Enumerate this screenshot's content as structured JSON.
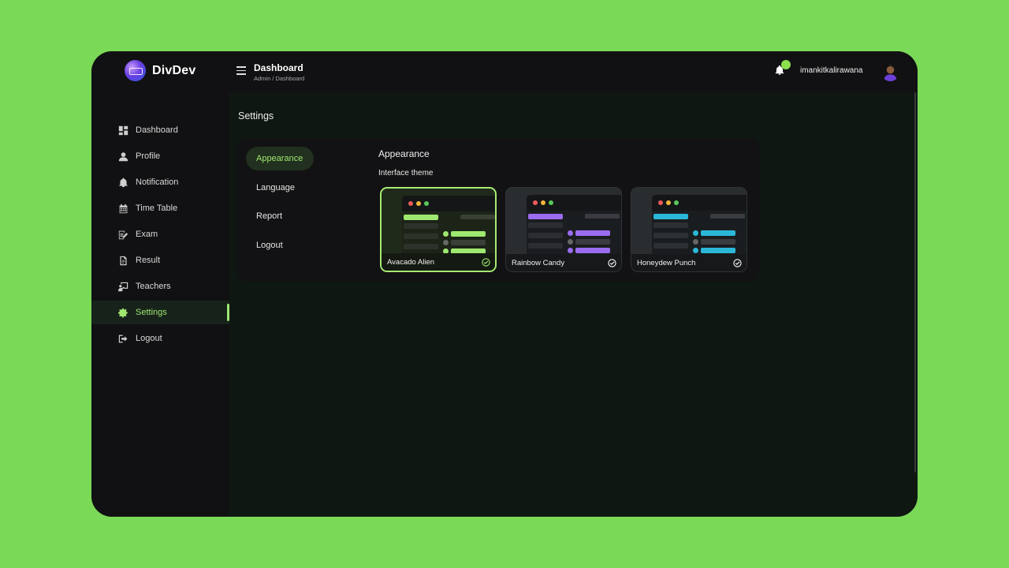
{
  "brand": {
    "name": "DivDev"
  },
  "header": {
    "title": "Dashboard",
    "breadcrumb": "Admin / Dashboard",
    "notification_count": "",
    "username": "imankitkalirawana"
  },
  "sidebar": {
    "items": [
      {
        "label": "Dashboard",
        "icon": "dashboard-icon"
      },
      {
        "label": "Profile",
        "icon": "user-icon"
      },
      {
        "label": "Notification",
        "icon": "bell-icon"
      },
      {
        "label": "Time Table",
        "icon": "calendar-icon"
      },
      {
        "label": "Exam",
        "icon": "edit-document-icon"
      },
      {
        "label": "Result",
        "icon": "file-icon"
      },
      {
        "label": "Teachers",
        "icon": "chalkboard-teacher-icon"
      },
      {
        "label": "Settings",
        "icon": "gear-icon",
        "active": true
      },
      {
        "label": "Logout",
        "icon": "logout-icon"
      }
    ]
  },
  "main": {
    "section_title": "Settings",
    "tabs": [
      {
        "label": "Appearance",
        "active": true
      },
      {
        "label": "Language"
      },
      {
        "label": "Report"
      },
      {
        "label": "Logout"
      }
    ],
    "pane_title": "Appearance",
    "pane_subtitle": "Interface theme",
    "themes": [
      {
        "name": "Avacado Alien",
        "accent": "#9fe870",
        "selected": true
      },
      {
        "name": "Rainbow Candy",
        "accent": "#9b6cf0"
      },
      {
        "name": "Honeydew Punch",
        "accent": "#2bb8d8"
      }
    ]
  },
  "colors": {
    "background": "#7ad957",
    "accent": "#9fe870",
    "window": "#111113"
  }
}
